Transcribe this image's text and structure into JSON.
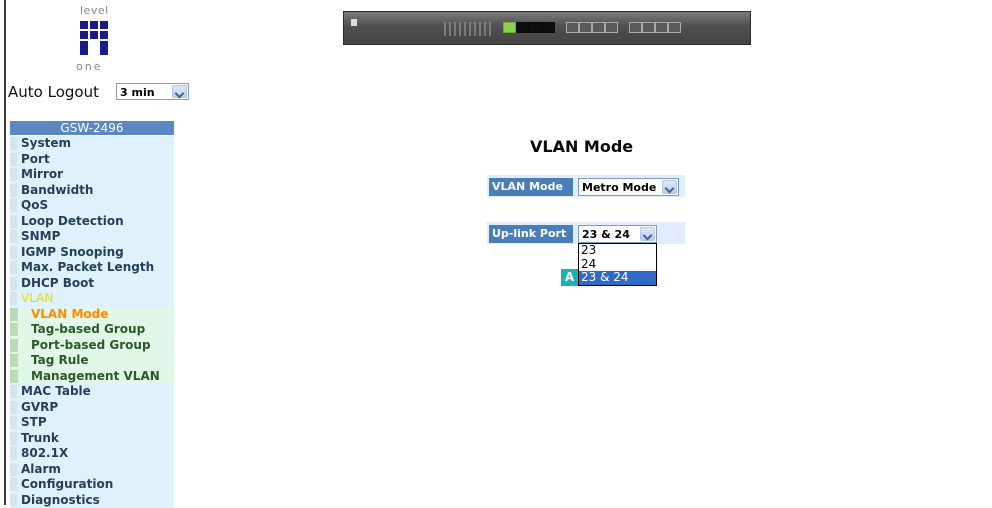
{
  "logo": {
    "top_text": "level",
    "bottom_text": "one"
  },
  "auto_logout": {
    "label": "Auto Logout",
    "value": "3 min"
  },
  "menu": {
    "title": "GSW-2496",
    "items": [
      "System",
      "Port",
      "Mirror",
      "Bandwidth",
      "QoS",
      "Loop Detection",
      "SNMP",
      "IGMP Snooping",
      "Max. Packet Length",
      "DHCP Boot",
      "VLAN"
    ],
    "vlan_sub": [
      "VLAN Mode",
      "Tag-based Group",
      "Port-based Group",
      "Tag Rule",
      "Management VLAN"
    ],
    "items_after": [
      "MAC Table",
      "GVRP",
      "STP",
      "Trunk",
      "802.1X",
      "Alarm",
      "Configuration",
      "Diagnostics"
    ]
  },
  "page": {
    "title": "VLAN Mode",
    "vlan_mode_label": "VLAN Mode",
    "vlan_mode_value": "Metro Mode",
    "uplink_label": "Up-link Port",
    "uplink_value": "23 & 24",
    "uplink_options": [
      "23",
      "24",
      "23 & 24"
    ],
    "uplink_selected_index": 2,
    "apply_label": "A"
  },
  "colors": {
    "menu_header": "#5b88c0",
    "menu_bg": "#dff2fc",
    "submenu_bg": "#e1f7e8",
    "active_sub": "#ff8a00",
    "vlan_label": "#e8dc00",
    "label_cell": "#4a7eb8",
    "apply_button": "#1ab2b2",
    "listbox_selected": "#316ac5"
  }
}
